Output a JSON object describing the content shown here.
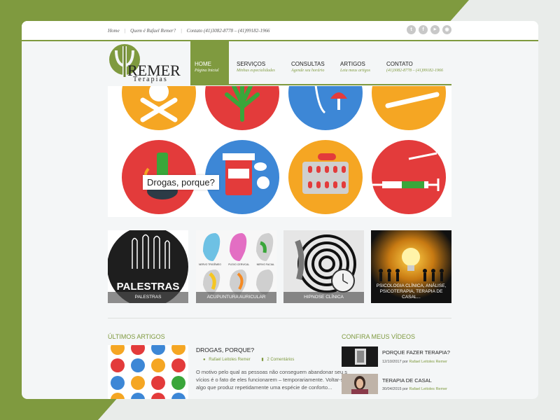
{
  "colors": {
    "brand": "#7f9a3f",
    "text": "#222222",
    "muted": "#555555"
  },
  "topbar": {
    "links": [
      "Home",
      "Quem é Rafael Remer?",
      "Contato (41)3082-8778 – (41)99182-1966"
    ],
    "separator": "|",
    "social": [
      {
        "icon": "twitter-icon",
        "glyph": "t"
      },
      {
        "icon": "facebook-icon",
        "glyph": "f"
      },
      {
        "icon": "youtube-icon",
        "glyph": "▶"
      },
      {
        "icon": "rss-icon",
        "glyph": "◉"
      }
    ]
  },
  "logo": {
    "name": "REMER",
    "tagline": "Terapias"
  },
  "nav": [
    {
      "title": "Home",
      "sub": "Página Inicial"
    },
    {
      "title": "Serviços",
      "sub": "Minhas especialidades"
    },
    {
      "title": "Consultas",
      "sub": "Agende seu horário"
    },
    {
      "title": "Artigos",
      "sub": "Leia meus artigos"
    },
    {
      "title": "Contato",
      "sub": "(41)3082-8778 – (41)99182-1966"
    }
  ],
  "hero": {
    "label": "Drogas, porque?"
  },
  "services": [
    {
      "caption": "Palestras",
      "overlay": "PALESTRAS"
    },
    {
      "caption": "Acupuntura Auricular",
      "labels": [
        "NERVO TRIGÊMEO",
        "PLEXO CERVICAL",
        "NERVO FACIAL"
      ]
    },
    {
      "caption": "Hipnose Clínica"
    },
    {
      "caption": "Psicologia Clínica, Análise, Psicoterapia, Terapia de Casal..."
    }
  ],
  "articles": {
    "section_title": "Últimos artigos",
    "items": [
      {
        "title": "Drogas, porque?",
        "author": "Rafael Leitoles Remer",
        "comments": "2 Comentários",
        "excerpt": "O motivo pelo qual as pessoas não conseguem abandonar seu s vícios é o fato de eles funcionarem – temporariamente. Voltar-se para algo que produz repetidamente uma espécie de conforto..."
      }
    ]
  },
  "videos": {
    "section_title": "Confira meus vídeos",
    "by": "por",
    "items": [
      {
        "title": "Porque fazer terapia?",
        "date": "12/10/2017",
        "author": "Rafael Leitoles Remer"
      },
      {
        "title": "Terapia de casal",
        "date": "30/04/2015",
        "author": "Rafael Leitoles Remer"
      }
    ]
  }
}
